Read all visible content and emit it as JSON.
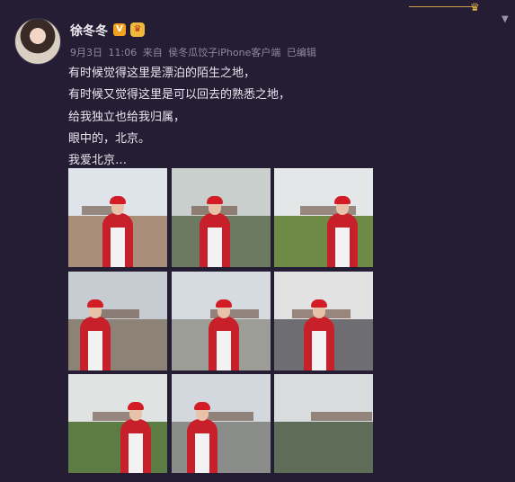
{
  "post": {
    "author": "徐冬冬",
    "badge_v": "V",
    "badge_medal": "♛",
    "date": "9月3日",
    "time": "11:06",
    "source_prefix": "来自",
    "source_app": "侯冬瓜饺子iPhone客户端",
    "edited": "已编辑",
    "lines": [
      "有时候觉得这里是漂泊的陌生之地，",
      "有时候又觉得这里是可以回去的熟悉之地，",
      "给我独立也给我归属，",
      "眼中的，北京。",
      "我爱北京…"
    ]
  },
  "icons": {
    "crown": "crown-icon",
    "chevron": "chevron-down-icon"
  },
  "photos": [
    {
      "name": "photo-forbidden-city-gate",
      "sky": "#dfe4ea",
      "ground": "#a98f7a"
    },
    {
      "name": "photo-great-wall-wave",
      "sky": "#c9cfcd",
      "ground": "#6c7a61"
    },
    {
      "name": "photo-great-wall-greenery",
      "sky": "#e3e7e8",
      "ground": "#6f8a45"
    },
    {
      "name": "photo-palace-rooftop",
      "sky": "#c7ccd2",
      "ground": "#8d8276"
    },
    {
      "name": "photo-tiananmen-square",
      "sky": "#d6dbe0",
      "ground": "#9b9d96"
    },
    {
      "name": "photo-subway-passage",
      "sky": "#e2e2e2",
      "ground": "#6e6e72"
    },
    {
      "name": "photo-great-wall-profile",
      "sky": "#dfe3e2",
      "ground": "#5d7b44"
    },
    {
      "name": "photo-corner-tower-moat",
      "sky": "#d2d8de",
      "ground": "#8a8d8a"
    },
    {
      "name": "photo-great-wall-mist",
      "sky": "#d9dcdd",
      "ground": "#5f6d58"
    }
  ]
}
